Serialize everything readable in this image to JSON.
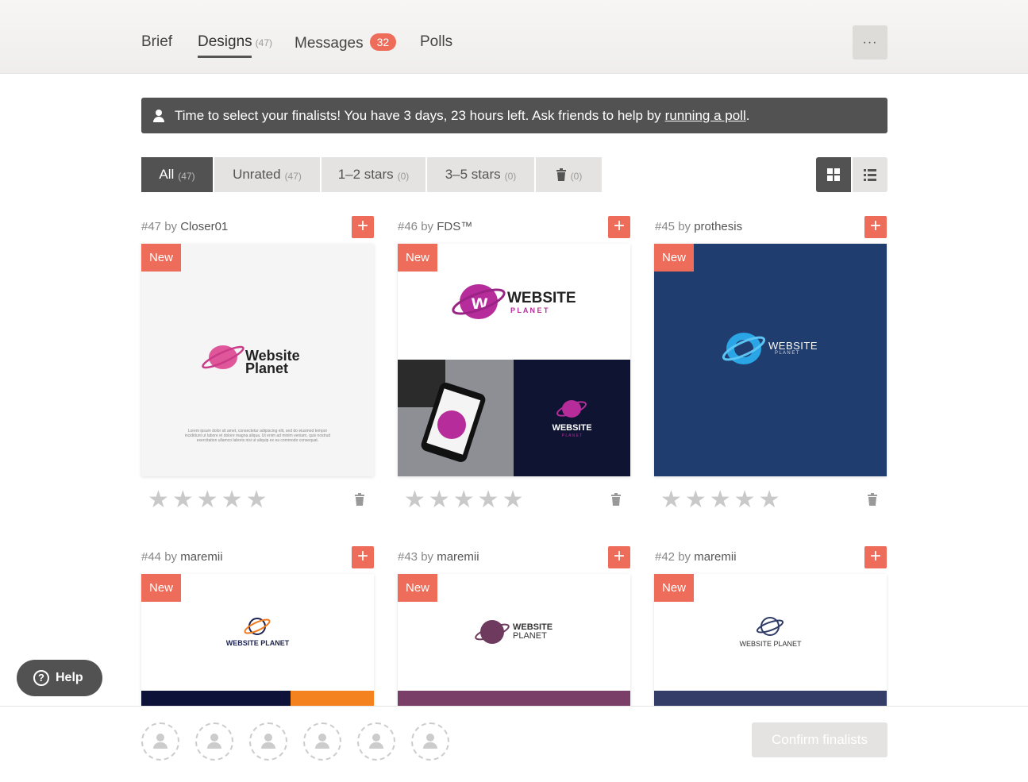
{
  "nav": {
    "brief": "Brief",
    "designs": "Designs",
    "designs_count": "(47)",
    "messages": "Messages",
    "messages_badge": "32",
    "polls": "Polls",
    "more": "···"
  },
  "banner": {
    "text": "Time to select your finalists! You have 3 days, 23 hours left. Ask friends to help by",
    "link": "running a poll",
    "end": "."
  },
  "filters": [
    {
      "label": "All",
      "count": "(47)"
    },
    {
      "label": "Unrated",
      "count": "(47)"
    },
    {
      "label": "1–2 stars",
      "count": "(0)"
    },
    {
      "label": "3–5 stars",
      "count": "(0)"
    },
    {
      "label": "",
      "count": "(0)"
    }
  ],
  "cards": [
    {
      "num": "#47",
      "by": "by",
      "author": "Closer01",
      "tag": "New",
      "logo_line1": "Website",
      "logo_line2": "Planet",
      "lorem": "Lorem ipsum dolor sit amet, consectetur adipiscing elit, sed do eiusmod tempor incididunt ut labore et dolore magna aliqua. Ut enim ad minim veniam, quis nostrud exercitation ullamco laboris nisi ut aliquip ex ea commodo consequat."
    },
    {
      "num": "#46",
      "by": "by",
      "author": "FDS™",
      "tag": "New",
      "logo_line1": "WEBSITE",
      "logo_line2": "P L A N E T",
      "logo_small1": "WEBSITE",
      "logo_small2": "P L A N E T"
    },
    {
      "num": "#45",
      "by": "by",
      "author": "prothesis",
      "tag": "New",
      "logo_line1": "WEBSITE",
      "logo_line2": "P L A N E T"
    },
    {
      "num": "#44",
      "by": "by",
      "author": "maremii",
      "tag": "New",
      "logo_line1": "WEBSITE PLANET"
    },
    {
      "num": "#43",
      "by": "by",
      "author": "maremii",
      "tag": "New",
      "logo_line1": "WEBSITE",
      "logo_line2": "PLANET"
    },
    {
      "num": "#42",
      "by": "by",
      "author": "maremii",
      "tag": "New",
      "logo_line1": "WEBSITE PLANET"
    }
  ],
  "help": "Help",
  "confirm": "Confirm finalists",
  "colors": {
    "accent": "#ee6c5a",
    "dark": "#525252",
    "navy": "#1f3d6e"
  }
}
